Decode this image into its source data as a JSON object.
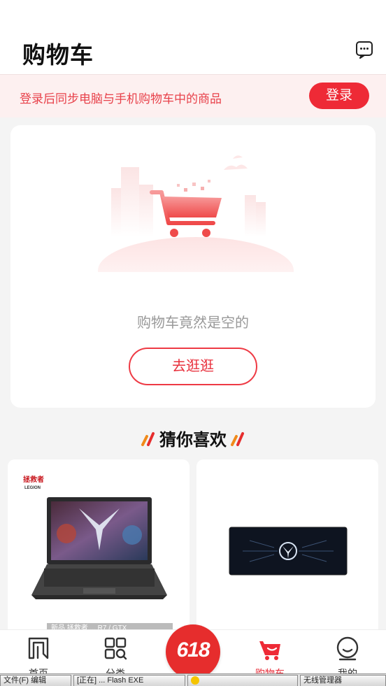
{
  "header": {
    "title": "购物车",
    "message_icon": "message-icon"
  },
  "login_bar": {
    "tip": "登录后同步电脑与手机购物车中的商品",
    "button": "登录"
  },
  "empty_cart": {
    "illustration": "empty-cart-icon",
    "text": "购物车竟然是空的",
    "button": "去逛逛"
  },
  "recommend": {
    "title": "猜你喜欢"
  },
  "products": [
    {
      "image": "laptop",
      "brand": "拯救者",
      "brand_sub": "LEGION",
      "caption": "新品 拯救者 ... R7 / GTX"
    },
    {
      "image": "mouse-pad"
    }
  ],
  "tabbar": {
    "items": [
      {
        "label": "首页",
        "icon": "home-icon"
      },
      {
        "label": "分类",
        "icon": "category-icon"
      },
      {
        "label": "618",
        "icon": "promo-618"
      },
      {
        "label": "购物车",
        "icon": "cart-icon",
        "active": true
      },
      {
        "label": "我的",
        "icon": "profile-icon"
      }
    ]
  },
  "taskbar": {
    "items": [
      "文件(F) 编辑",
      "[正在] ... Flash EXE",
      "",
      "无线管理器"
    ]
  },
  "colors": {
    "accent": "#ee2a36",
    "tip_bg": "#fdf0f0",
    "page_bg": "#f4f4f4"
  }
}
